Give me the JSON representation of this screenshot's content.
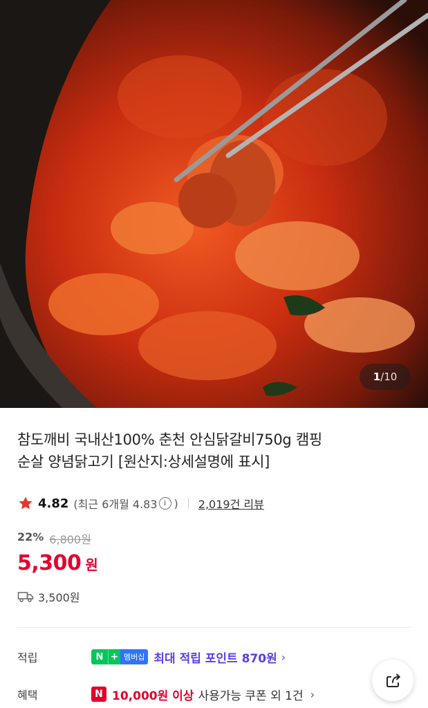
{
  "gallery": {
    "current": "1",
    "separator": "/",
    "total": "10"
  },
  "product": {
    "title_line1": "참도깨비 국내산100% 춘천 안심닭갈비750g 캠핑",
    "title_line2": "순살 양념닭고기 [원산지:상세설명에 표시]",
    "rating": "4.82",
    "recent_rating": "(최근 6개월 4.83",
    "recent_close": ")",
    "info_icon": "i",
    "review_count": "2,019건 리뷰",
    "discount_rate": "22%",
    "original_price": "6,800원",
    "sale_price": "5,300",
    "price_unit": "원",
    "shipping_fee": "3,500원"
  },
  "benefits": {
    "points_label": "적립",
    "nplus_n": "N",
    "nplus_plus": "+",
    "nplus_member": "멤버십",
    "max_point": "최대 적립 포인트 870원",
    "points_chevron": "›",
    "benefit_label": "혜택",
    "n_badge": "N",
    "coupon_amount": "10,000원 이상",
    "coupon_rest": "사용가능 쿠폰 외 1건",
    "coupon_chevron": "›"
  },
  "colors": {
    "sale_red": "#e3002d",
    "point_purple": "#5c3ee8",
    "naver_green": "#03c75a",
    "star_red": "#e8352b"
  },
  "icons": [
    "star-icon",
    "info-icon",
    "truck-icon",
    "share-icon",
    "chevron-right-icon"
  ]
}
